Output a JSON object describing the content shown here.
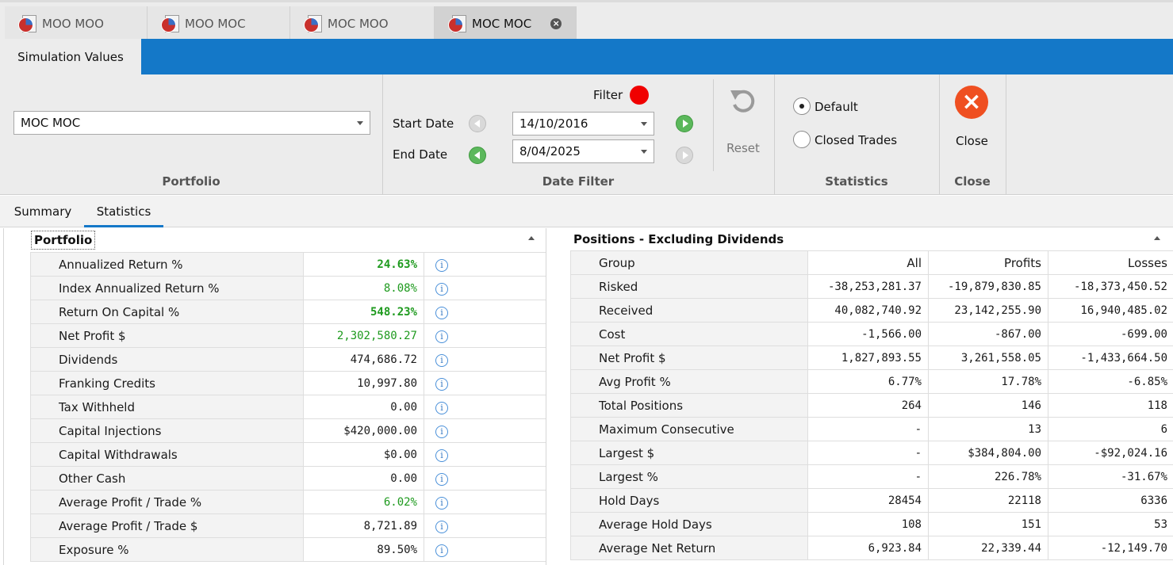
{
  "doc_tabs": [
    {
      "label": "MOO MOO",
      "active": false
    },
    {
      "label": "MOO MOC",
      "active": false
    },
    {
      "label": "MOC MOO",
      "active": false
    },
    {
      "label": "MOC MOC",
      "active": true
    }
  ],
  "ribbon": {
    "tab_label": "Simulation Values",
    "portfolio": {
      "value": "MOC MOC",
      "group_label": "Portfolio"
    },
    "date_filter": {
      "filter_label": "Filter",
      "start_label": "Start Date",
      "start_value": "14/10/2016",
      "end_label": "End Date",
      "end_value": "8/04/2025",
      "reset_label": "Reset",
      "group_label": "Date Filter"
    },
    "statistics": {
      "default_label": "Default",
      "closed_label": "Closed Trades",
      "group_label": "Statistics"
    },
    "close": {
      "button_label": "Close",
      "group_label": "Close"
    }
  },
  "sub_tabs": [
    "Summary",
    "Statistics"
  ],
  "portfolio_panel": {
    "title": "Portfolio",
    "rows": [
      {
        "name": "Annualized Return %",
        "value": "24.63%",
        "style": "green-bold"
      },
      {
        "name": "Index Annualized Return %",
        "value": "8.08%",
        "style": "green"
      },
      {
        "name": "Return On Capital %",
        "value": "548.23%",
        "style": "green-bold"
      },
      {
        "name": "Net Profit $",
        "value": "2,302,580.27",
        "style": "green"
      },
      {
        "name": "Dividends",
        "value": "474,686.72",
        "style": ""
      },
      {
        "name": "Franking Credits",
        "value": "10,997.80",
        "style": ""
      },
      {
        "name": "Tax Withheld",
        "value": "0.00",
        "style": ""
      },
      {
        "name": "Capital Injections",
        "value": "$420,000.00",
        "style": ""
      },
      {
        "name": "Capital Withdrawals",
        "value": "$0.00",
        "style": ""
      },
      {
        "name": "Other Cash",
        "value": "0.00",
        "style": ""
      },
      {
        "name": "Average Profit / Trade %",
        "value": "6.02%",
        "style": "green"
      },
      {
        "name": "Average Profit / Trade $",
        "value": "8,721.89",
        "style": ""
      },
      {
        "name": "Exposure %",
        "value": "89.50%",
        "style": ""
      }
    ]
  },
  "positions_panel": {
    "title": "Positions - Excluding Dividends",
    "columns": [
      "Group",
      "All",
      "Profits",
      "Losses"
    ],
    "rows": [
      [
        "Risked",
        "-38,253,281.37",
        "-19,879,830.85",
        "-18,373,450.52"
      ],
      [
        "Received",
        "40,082,740.92",
        "23,142,255.90",
        "16,940,485.02"
      ],
      [
        "Cost",
        "-1,566.00",
        "-867.00",
        "-699.00"
      ],
      [
        "Net Profit $",
        "1,827,893.55",
        "3,261,558.05",
        "-1,433,664.50"
      ],
      [
        "Avg Profit %",
        "6.77%",
        "17.78%",
        "-6.85%"
      ],
      [
        "Total Positions",
        "264",
        "146",
        "118"
      ],
      [
        "Maximum Consecutive",
        "-",
        "13",
        "6"
      ],
      [
        "Largest $",
        "-",
        "$384,804.00",
        "-$92,024.16"
      ],
      [
        "Largest %",
        "-",
        "226.78%",
        "-31.67%"
      ],
      [
        "Hold Days",
        "28454",
        "22118",
        "6336"
      ],
      [
        "Average Hold Days",
        "108",
        "151",
        "53"
      ],
      [
        "Average Net Return",
        "6,923.84",
        "22,339.44",
        "-12,149.70"
      ]
    ]
  },
  "colors": {
    "accent": "#1478c8",
    "positive": "#1e9a1e",
    "filter_dot": "#f00000",
    "close_icon": "#ef4f21"
  }
}
